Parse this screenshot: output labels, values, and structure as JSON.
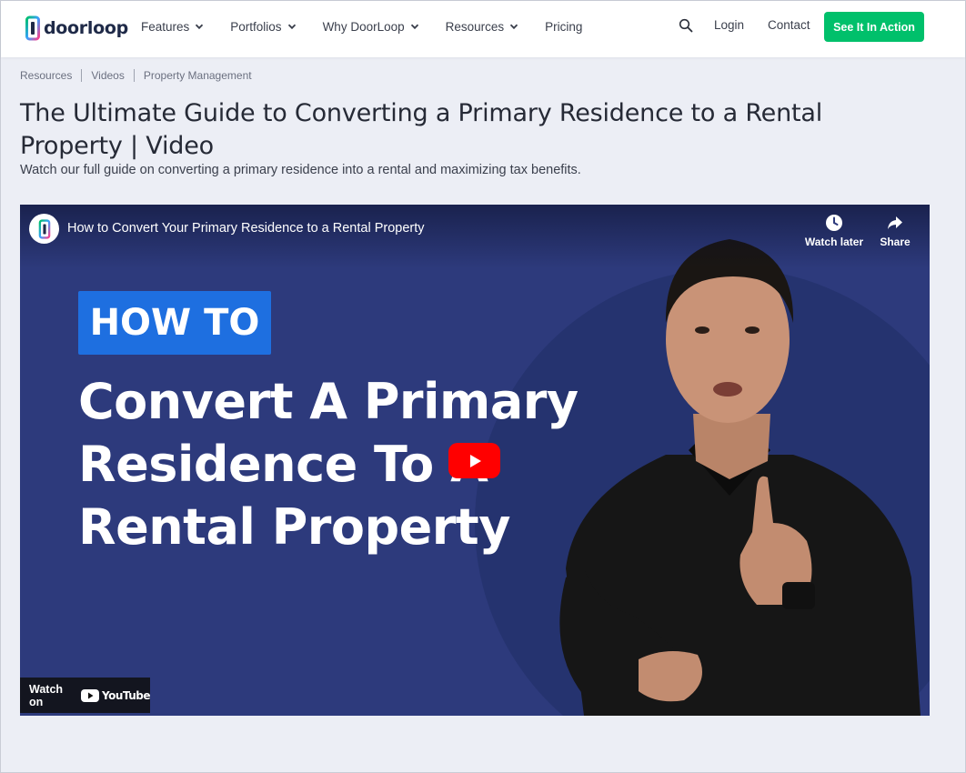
{
  "brand": {
    "name": "doorloop"
  },
  "nav": {
    "items": [
      {
        "label": "Features",
        "dropdown": true
      },
      {
        "label": "Portfolios",
        "dropdown": true
      },
      {
        "label": "Why DoorLoop",
        "dropdown": true
      },
      {
        "label": "Resources",
        "dropdown": true
      },
      {
        "label": "Pricing",
        "dropdown": false
      }
    ],
    "login": "Login",
    "contact": "Contact",
    "cta": "See It In Action"
  },
  "breadcrumb": [
    "Resources",
    "Videos",
    "Property Management"
  ],
  "page": {
    "title": "The Ultimate Guide to Converting a Primary Residence to a Rental Property | Video",
    "subtitle": "Watch our full guide on converting a primary residence into a rental and maximizing tax benefits."
  },
  "video": {
    "title": "How to Convert Your Primary Residence to a Rental Property",
    "watch_later": "Watch later",
    "share": "Share",
    "badge": "HOW TO",
    "headline": [
      "Convert A Primary",
      "Residence To A",
      "Rental Property"
    ],
    "watch_on": "Watch on",
    "youtube": "YouTube"
  },
  "colors": {
    "cta": "#00c06b",
    "video_bg": "#2d3a7c",
    "badge": "#1e6fe0",
    "play": "#ff0000"
  }
}
